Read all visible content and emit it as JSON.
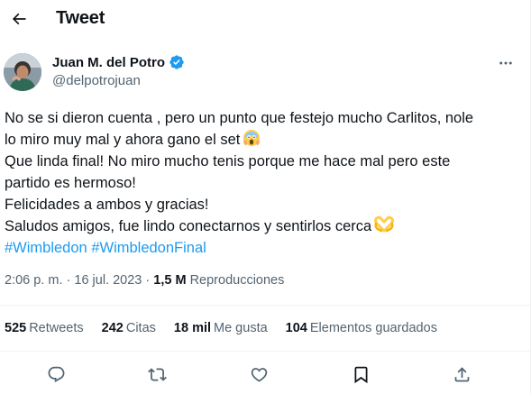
{
  "header": {
    "title": "Tweet",
    "back_icon": "arrow-left-icon"
  },
  "author": {
    "name": "Juan M. del Potro",
    "handle": "@delpotrojuan",
    "verified_icon": "verified-badge-icon",
    "more_icon": "more-horizontal-icon"
  },
  "tweet": {
    "lines": [
      "No se si dieron cuenta , pero un punto que festejo mucho Carlitos, nole",
      "lo miro muy mal y ahora gano el set",
      "Que linda final! No miro mucho tenis porque me hace mal pero este",
      "partido es hermoso!",
      "Felicidades a ambos y gracias!",
      "Saludos amigos, fue lindo conectarnos y sentirlos cerca"
    ],
    "emoji_1": "screaming-face-emoji",
    "emoji_2": "heart-hands-emoji",
    "hashtags": [
      "#Wimbledon",
      "#WimbledonFinal"
    ]
  },
  "meta": {
    "time": "2:06 p. m.",
    "separator": "·",
    "date": "16 jul. 2023",
    "views_count": "1,5 M",
    "views_label": "Reproducciones"
  },
  "stats": [
    {
      "count": "525",
      "label": "Retweets"
    },
    {
      "count": "242",
      "label": "Citas"
    },
    {
      "count": "18 mil",
      "label": "Me gusta"
    },
    {
      "count": "104",
      "label": "Elementos guardados"
    }
  ],
  "actions": [
    "reply-icon",
    "retweet-icon",
    "like-icon",
    "bookmark-icon",
    "share-icon"
  ],
  "colors": {
    "text": "#0f1419",
    "secondary": "#536471",
    "link": "#1d9bf0",
    "divider": "#eff3f4"
  }
}
